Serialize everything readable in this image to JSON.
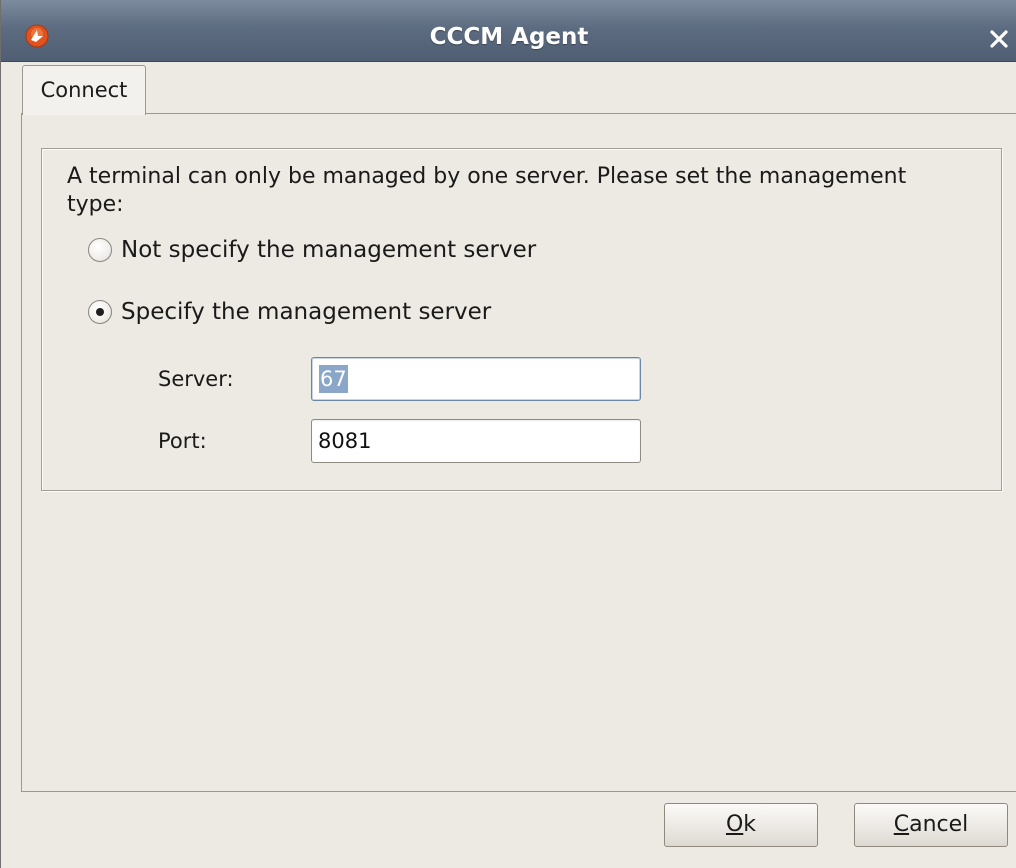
{
  "window": {
    "title": "CCCM Agent"
  },
  "tabs": [
    {
      "label": "Connect",
      "selected": true
    }
  ],
  "connect": {
    "description": "A terminal can only be managed by one server. Please set the management type:",
    "options": [
      {
        "label": "Not specify the management server",
        "selected": false
      },
      {
        "label": "Specify the management server",
        "selected": true
      }
    ],
    "server": {
      "label": "Server:",
      "value": "67",
      "selected_text": true
    },
    "port": {
      "label": "Port:",
      "value": "8081"
    }
  },
  "buttons": {
    "ok": {
      "mnemonic": "O",
      "rest": "k"
    },
    "cancel": {
      "mnemonic": "C",
      "rest": "ancel"
    }
  },
  "icons": {
    "app": "app-logo-icon",
    "close": "close-icon"
  },
  "colors": {
    "titlebar": "#5d6c80",
    "window_bg": "#ede9e3",
    "selection": "#8aa6c8",
    "app_icon": "#e0531f"
  }
}
